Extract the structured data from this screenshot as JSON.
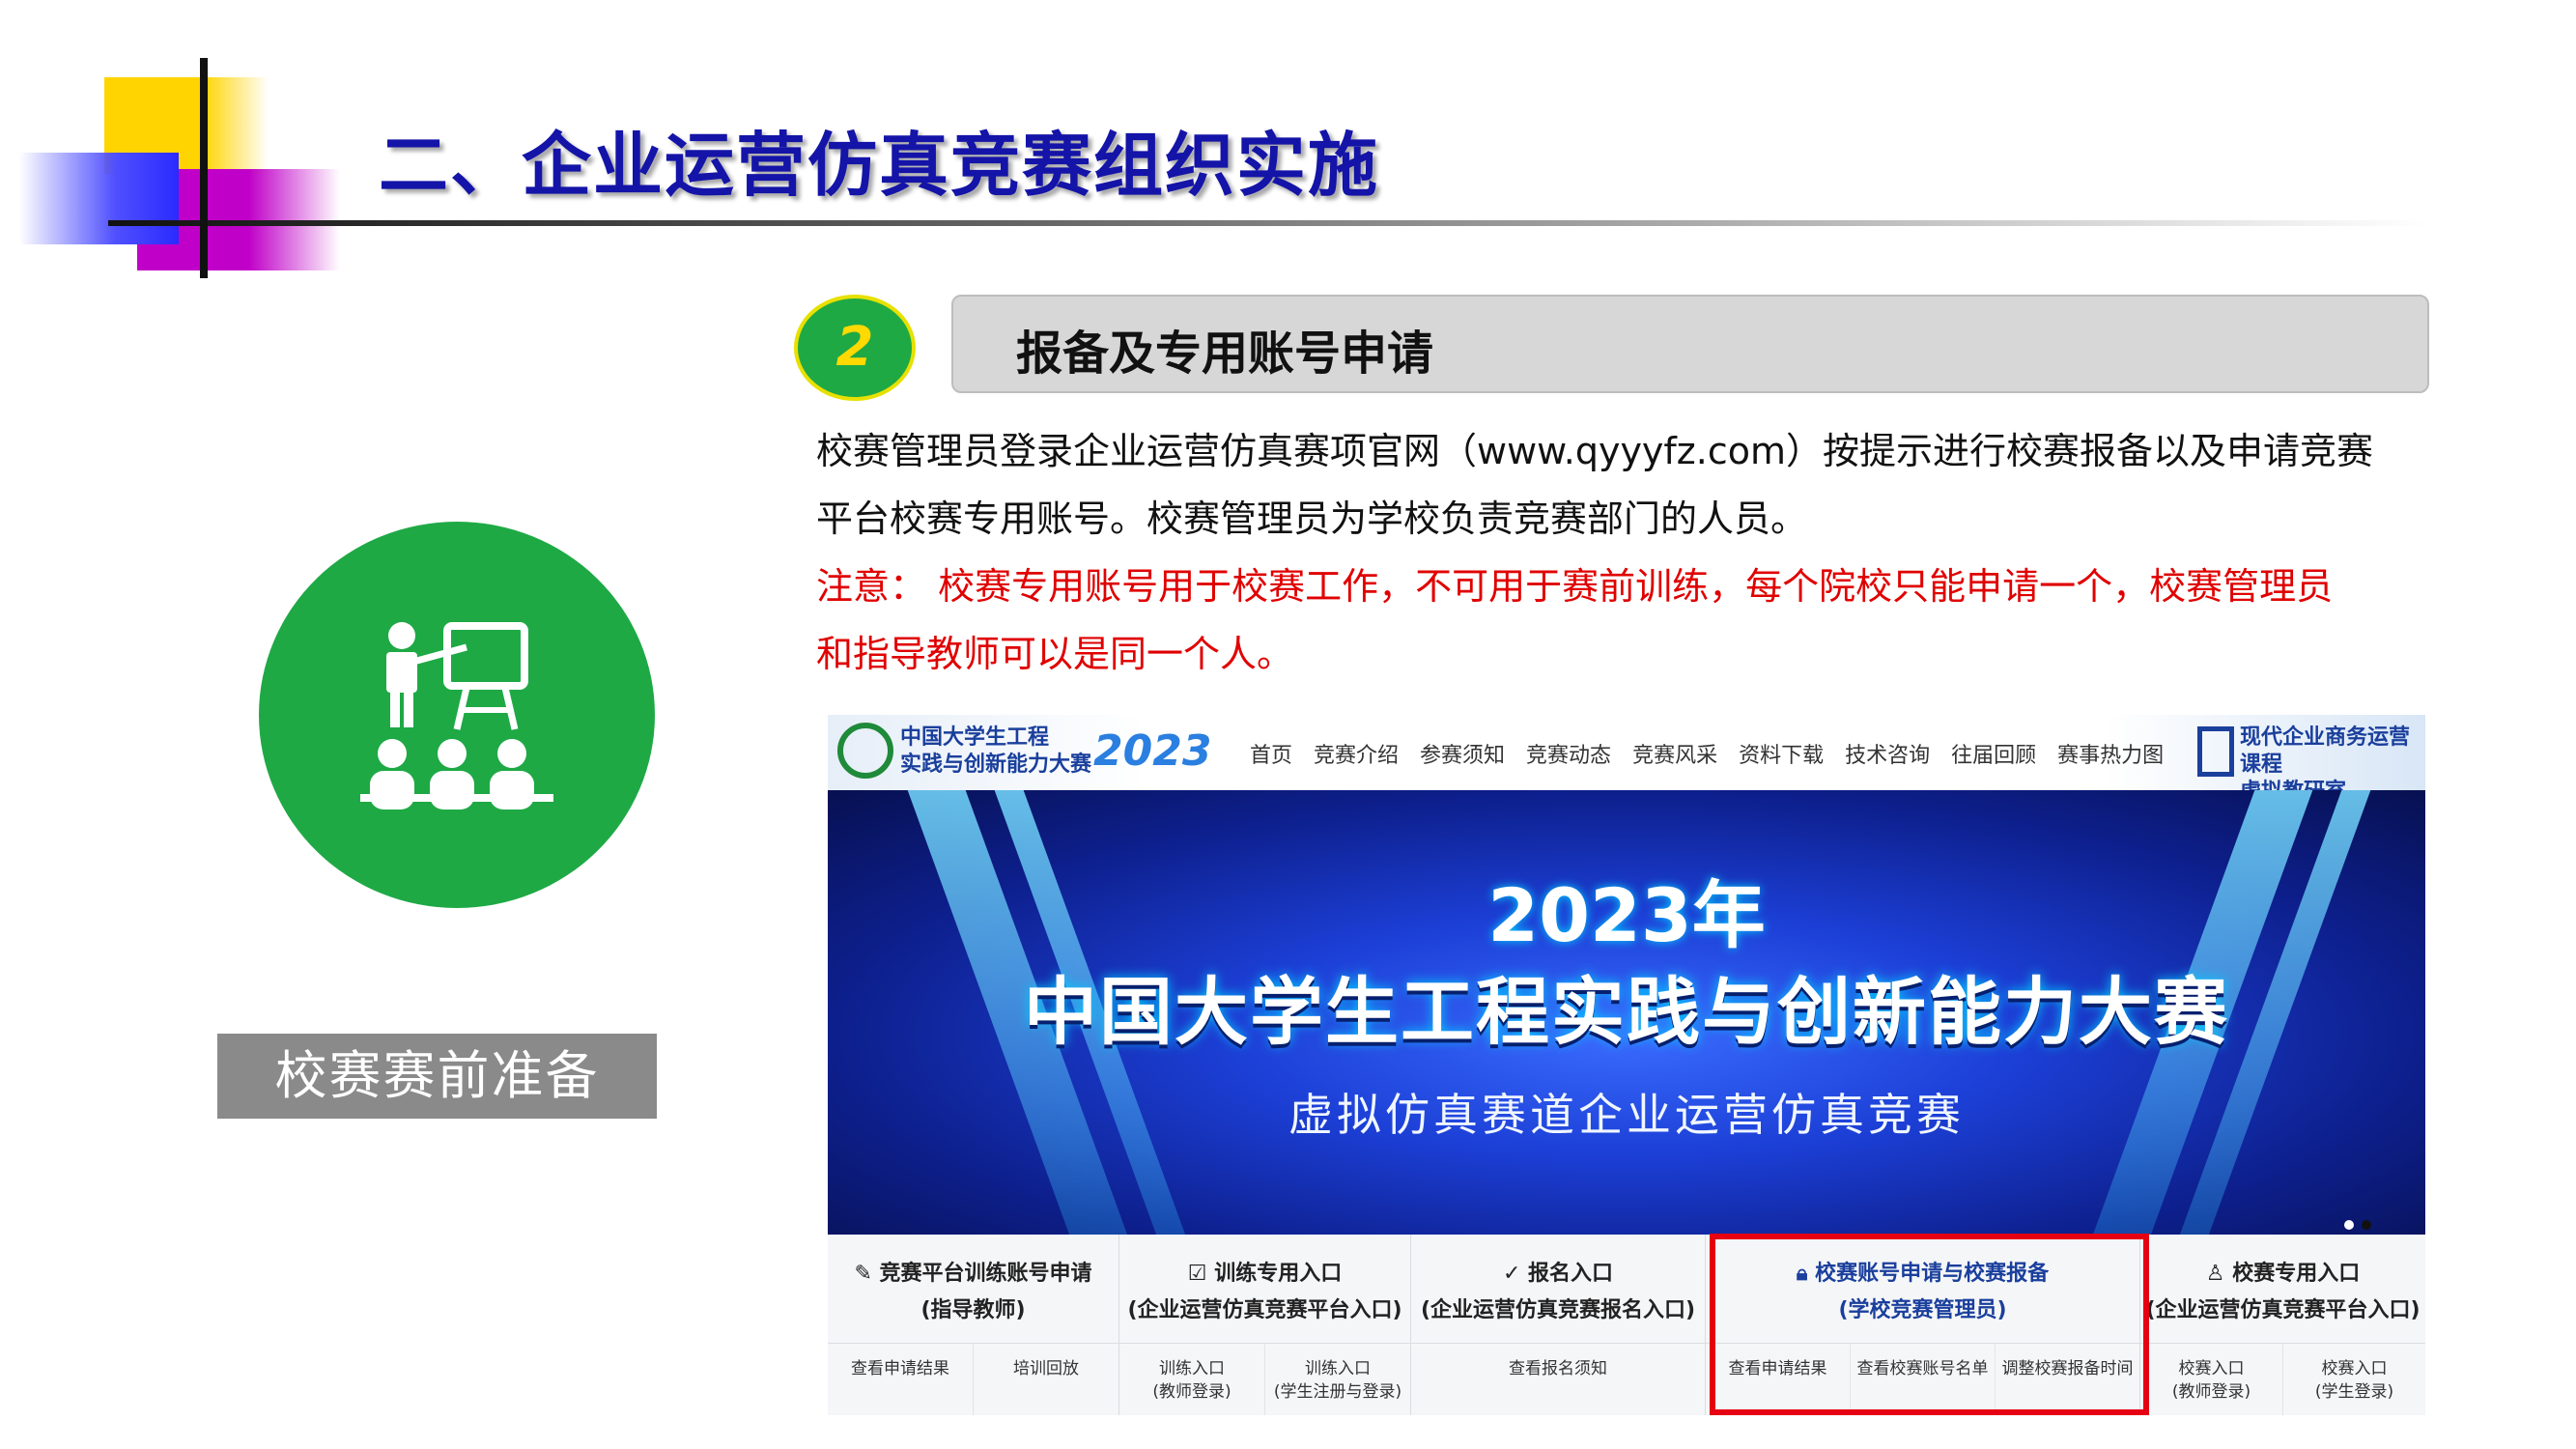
{
  "slide": {
    "title": "二、企业运营仿真竞赛组织实施",
    "left_label": "校赛赛前准备",
    "icon": "teacher-presentation-icon"
  },
  "step": {
    "number": "2",
    "title": "报备及专用账号申请",
    "para1": "校赛管理员登录企业运营仿真赛项官网（www.qyyyfz.com）按提示进行校赛报备以及申请竞赛",
    "para2": "平台校赛专用账号。校赛管理员为学校负责竞赛部门的人员。",
    "note1": "注意： 校赛专用账号用于校赛工作，不可用于赛前训练，每个院校只能申请一个，校赛管理员",
    "note2": "和指导教师可以是同一个人。"
  },
  "website": {
    "logo_left_line1": "中国大学生工程",
    "logo_left_line2": "实践与创新能力大赛",
    "logo_year": "2023",
    "nav": [
      "首页",
      "竞赛介绍",
      "参赛须知",
      "竞赛动态",
      "竞赛风采",
      "资料下载",
      "技术咨询",
      "往届回顾",
      "赛事热力图"
    ],
    "logo_right_line1": "现代企业商务运营课程",
    "logo_right_line2": "虚拟教研室",
    "banner_year": "2023年",
    "banner_title": "中国大学生工程实践与创新能力大赛",
    "banner_subtitle": "虚拟仿真赛道企业运营仿真竞赛",
    "entries": [
      {
        "icon": "pen-icon",
        "title": "竞赛平台训练账号申请",
        "subtitle": "(指导教师)",
        "links": [
          "查看申请结果",
          "培训回放"
        ]
      },
      {
        "icon": "checkbox-icon",
        "title": "训练专用入口",
        "subtitle": "(企业运营仿真竞赛平台入口)",
        "links": [
          "训练入口\n(教师登录)",
          "训练入口\n(学生注册与登录)"
        ]
      },
      {
        "icon": "check-icon",
        "title": "报名入口",
        "subtitle": "(企业运营仿真竞赛报名入口)",
        "links": [
          "查看报名须知"
        ]
      },
      {
        "icon": "lock-icon",
        "title": "校赛账号申请与校赛报备",
        "subtitle": "(学校竞赛管理员)",
        "links": [
          "查看申请结果",
          "查看校赛账号名单",
          "调整校赛报备时间"
        ]
      },
      {
        "icon": "user-icon",
        "title": "校赛专用入口",
        "subtitle": "(企业运营仿真竞赛平台入口)",
        "links": [
          "校赛入口\n(教师登录)",
          "校赛入口\n(学生登录)"
        ]
      }
    ]
  },
  "colors": {
    "title_blue": "#1414a8",
    "green": "#1ea945",
    "note_red": "#e00000",
    "highlight_red": "#e60012"
  }
}
